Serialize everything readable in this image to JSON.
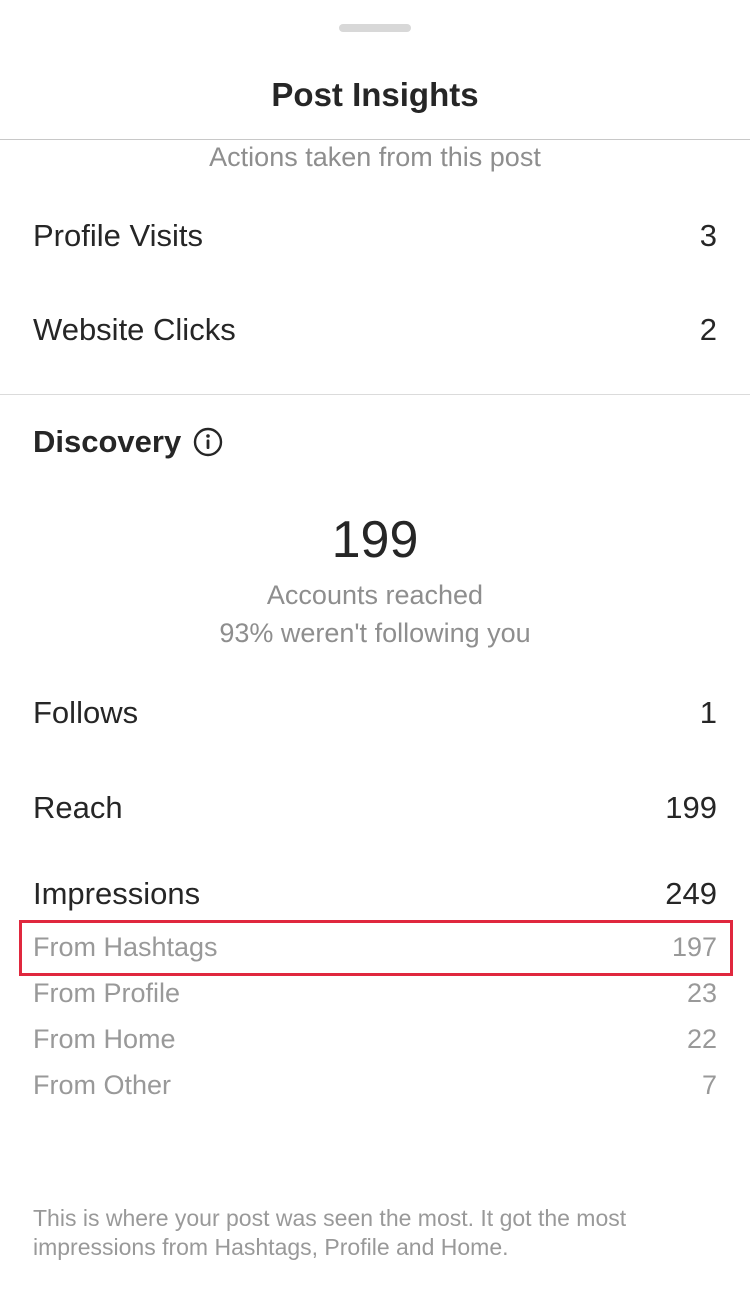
{
  "sheet": {
    "title": "Post Insights"
  },
  "actions": {
    "subheading": "Actions taken from this post",
    "rows": [
      {
        "label": "Profile Visits",
        "value": "3"
      },
      {
        "label": "Website Clicks",
        "value": "2"
      }
    ]
  },
  "discovery": {
    "title": "Discovery",
    "info_icon": "info-circle-icon",
    "accounts_reached": "199",
    "accounts_reached_label": "Accounts reached",
    "not_following_text": "93% weren't following you",
    "rows": [
      {
        "label": "Follows",
        "value": "1"
      },
      {
        "label": "Reach",
        "value": "199"
      },
      {
        "label": "Impressions",
        "value": "249"
      }
    ],
    "impression_sources": [
      {
        "label": "From Hashtags",
        "value": "197"
      },
      {
        "label": "From Profile",
        "value": "23"
      },
      {
        "label": "From Home",
        "value": "22"
      },
      {
        "label": "From Other",
        "value": "7"
      }
    ],
    "highlight_color": "#e0283e",
    "footer_note": "This is where your post was seen the most. It got the most impressions from Hashtags, Profile and Home."
  }
}
